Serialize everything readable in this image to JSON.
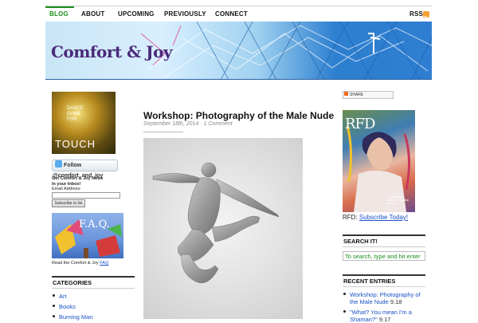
{
  "nav": {
    "items": [
      "BLOG",
      "ABOUT",
      "UPCOMING",
      "PREVIOUSLY",
      "CONNECT"
    ],
    "rss": "RSS"
  },
  "header": {
    "logo": "Comfort & Joy"
  },
  "sidebar_left": {
    "touch": {
      "small": [
        "DANCE",
        "GAME",
        "FOR"
      ],
      "big": "TOUCH"
    },
    "twitter": {
      "label": "Follow @comfort_and_joy"
    },
    "newsletter": {
      "line1": "Get Comfort & Joy News",
      "line2": "in your Inbox!",
      "email_label": "Email Address:",
      "email_value": "",
      "subscribe_label": "Subscribe to list"
    },
    "faq": {
      "image_text": "F.A.Q.",
      "caption": "Read the Comfort & Joy",
      "link": "FAQ"
    },
    "categories": {
      "title": "CATEGORIES",
      "items": [
        "Art",
        "Books",
        "Burning Man"
      ]
    }
  },
  "post": {
    "title": "Workshop: Photography of the Male Nude",
    "date": "September 18th, 2014",
    "separator": "·",
    "comments": "1 Comment"
  },
  "sidebar_right": {
    "share": {
      "label": "SHARE"
    },
    "rfd": {
      "logo": "RFD",
      "tagline": "Contemporary Journal of Radical Faerie",
      "label": "RFD:",
      "link": "Subscribe Today!"
    },
    "search": {
      "title": "SEARCH IT!",
      "placeholder": "To search, type and hit enter"
    },
    "recent": {
      "title": "RECENT ENTRIES",
      "items": [
        {
          "title_l1": "Workshop: Photography of",
          "title_l2": "the Male Nude",
          "date": "9.18"
        },
        {
          "title_l1": "\"What? You mean I'm a",
          "title_l2": "Shaman?\"",
          "date": "9.17"
        }
      ]
    }
  },
  "colors": {
    "nav_active": "#1a8f1a",
    "link": "#1a50c8",
    "logo": "#4b2a7a",
    "rss": "#f7a230"
  }
}
